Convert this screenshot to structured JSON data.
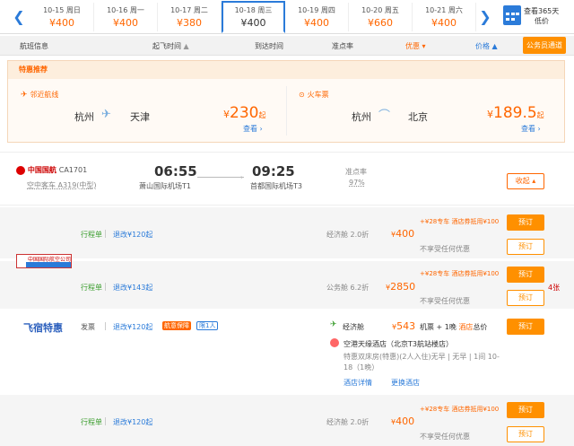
{
  "date_bar": {
    "prev_icon": "chevron-left-icon",
    "next_icon": "chevron-right-icon",
    "dates": [
      {
        "date": "10-15 周日",
        "price": "¥400"
      },
      {
        "date": "10-16 周一",
        "price": "¥400"
      },
      {
        "date": "10-17 周二",
        "price": "¥380"
      },
      {
        "date": "10-18 周三",
        "price": "¥400"
      },
      {
        "date": "10-19 周四",
        "price": "¥400"
      },
      {
        "date": "10-20 周五",
        "price": "¥660"
      },
      {
        "date": "10-21 周六",
        "price": "¥400"
      }
    ],
    "calendar_label_1": "查看365天",
    "calendar_label_2": "低价"
  },
  "header": {
    "flight_info": "航班信息",
    "depart_time": "起飞时间",
    "depart_arrow": "▲",
    "arrive_time": "到达时间",
    "on_time": "准点率",
    "discount": "优惠",
    "discount_arrow": "▾",
    "price": "价格",
    "price_arrow": "▲",
    "gov_button": "公务员通道"
  },
  "promo": {
    "title": "特惠推荐",
    "left_label": "邻近航线",
    "left_from": "杭州",
    "left_to": "天津",
    "left_currency": "¥",
    "left_price": "230",
    "left_suffix": "起",
    "left_link": "查看 ›",
    "right_label": "火车票",
    "right_from": "杭州",
    "right_to": "北京",
    "right_currency": "¥",
    "right_price": "189.5",
    "right_suffix": "起",
    "right_link": "查看 ›"
  },
  "flight": {
    "airline": "中国国航",
    "flight_no": "CA1701",
    "aircraft": "空中客车 A319(中型)",
    "depart": "06:55",
    "depart_airport": "萧山国际机场T1",
    "arrive": "09:25",
    "arrive_airport": "首都国际机场T3",
    "on_time_label": "准点率",
    "on_time_value": "97%",
    "fold_button": "收起 ▴"
  },
  "offers": [
    {
      "itinerary": "行程单",
      "refund": "退改¥120起",
      "cabin": "经济舱 2.0折",
      "currency": "¥",
      "price": "400",
      "promo": "+¥28专车 酒店券抵用¥100",
      "note": "不享受任何优惠",
      "book": "预订",
      "book2": "预订"
    },
    {
      "provider_logo": "中国国际航空公司",
      "itinerary": "行程单",
      "refund": "退改¥143起",
      "cabin": "公务舱 6.2折",
      "currency": "¥",
      "price": "2850",
      "promo": "+¥28专车 酒店券抵用¥100",
      "note": "不享受任何优惠",
      "seats": "4张",
      "book": "预订",
      "book2": "预订"
    },
    {
      "provider": "飞宿特惠",
      "invoice": "发票",
      "refund": "退改¥120起",
      "tag1": "航意保障",
      "tag2": "限1人",
      "cabin": "经济舱",
      "currency": "¥",
      "price": "543",
      "combo": "机票 + 1晚",
      "combo_hotel": "酒店",
      "combo_total": "总价",
      "hotel_name": "空港天缘酒店（北京T3航站楼店）",
      "hotel_desc_1": "特惠双床房(特惠)(2人入住)无早 | 无早 | 1间 10-",
      "hotel_desc_2": "18（1晚）",
      "hotel_detail": "酒店详情",
      "change_hotel": "更换酒店",
      "book": "预订"
    },
    {
      "itinerary": "行程单",
      "refund": "退改¥120起",
      "cabin": "经济舱 2.0折",
      "currency": "¥",
      "price": "400",
      "promo": "+¥28专车 酒店券抵用¥100",
      "note": "不享受任何优惠",
      "book": "预订",
      "book2": "预订"
    }
  ]
}
